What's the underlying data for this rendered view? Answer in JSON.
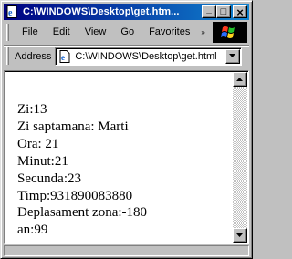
{
  "window": {
    "title": "C:\\WINDOWS\\Desktop\\get.htm..."
  },
  "title_buttons": {
    "minimize": "_",
    "maximize": "□",
    "close": "×"
  },
  "menu": {
    "items": [
      {
        "label": "File",
        "underline": "F",
        "rest": "ile"
      },
      {
        "label": "Edit",
        "underline": "E",
        "rest": "dit"
      },
      {
        "label": "View",
        "underline": "V",
        "rest": "iew"
      },
      {
        "label": "Go",
        "underline": "G",
        "rest": "o"
      },
      {
        "label": "Favorites",
        "underline": "a",
        "pre": "F",
        "rest": "vorites"
      }
    ],
    "more": "»"
  },
  "address": {
    "label": "Address",
    "value": "C:\\WINDOWS\\Desktop\\get.html"
  },
  "content": {
    "lines": [
      "Zi:13",
      "Zi saptamana: Marti",
      "Ora: 21",
      "Minut:21",
      "Secunda:23",
      "Timp:931890083880",
      "Deplasament zona:-180",
      "an:99"
    ]
  },
  "icons": {
    "title": "ie-page-icon",
    "address_page": "html-page-icon",
    "logo": "windows-logo-icon",
    "dropdown": "chevron-down-icon",
    "scroll_up": "scroll-up-arrow-icon",
    "scroll_down": "scroll-down-arrow-icon"
  },
  "colors": {
    "titlebar_start": "#000080",
    "titlebar_end": "#1084d0",
    "chrome": "#c0c0c0",
    "page_bg": "#ffffff"
  }
}
